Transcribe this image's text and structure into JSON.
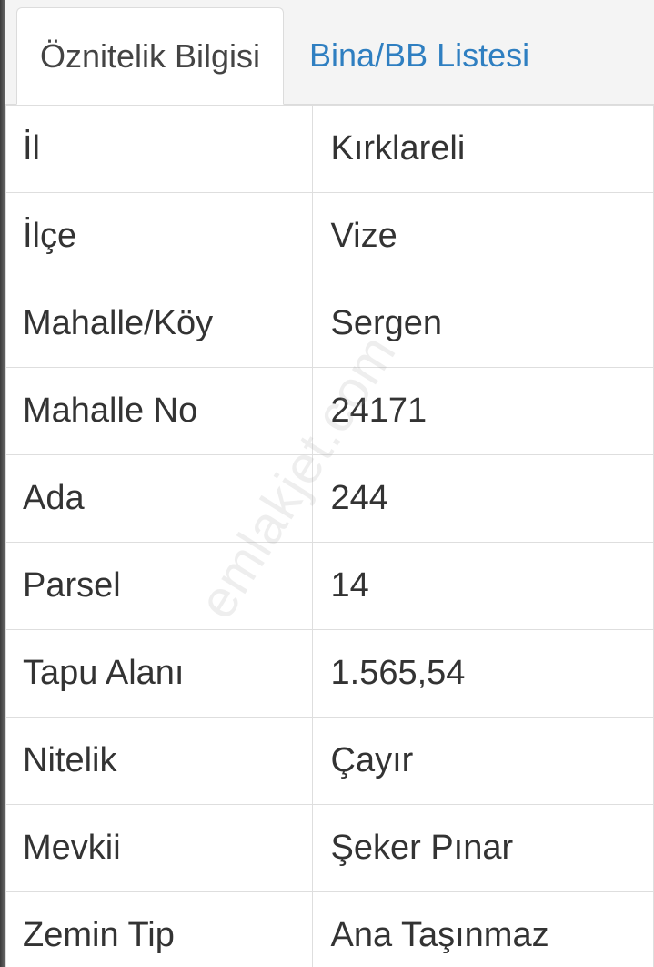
{
  "tabs": [
    {
      "label": "Öznitelik Bilgisi",
      "active": true
    },
    {
      "label": "Bina/BB Listesi",
      "active": false
    }
  ],
  "rows": [
    {
      "key": "İl",
      "value": "Kırklareli"
    },
    {
      "key": "İlçe",
      "value": "Vize"
    },
    {
      "key": "Mahalle/Köy",
      "value": "Sergen"
    },
    {
      "key": "Mahalle No",
      "value": "24171"
    },
    {
      "key": "Ada",
      "value": "244"
    },
    {
      "key": "Parsel",
      "value": "14"
    },
    {
      "key": "Tapu Alanı",
      "value": "1.565,54"
    },
    {
      "key": "Nitelik",
      "value": "Çayır"
    },
    {
      "key": "Mevkii",
      "value": "Şeker Pınar"
    },
    {
      "key": "Zemin Tip",
      "value": "Ana Taşınmaz"
    }
  ],
  "watermark": "emlakjet.com",
  "colors": {
    "tab_link": "#2f7fc1",
    "text": "#333333",
    "border": "#dedede"
  }
}
